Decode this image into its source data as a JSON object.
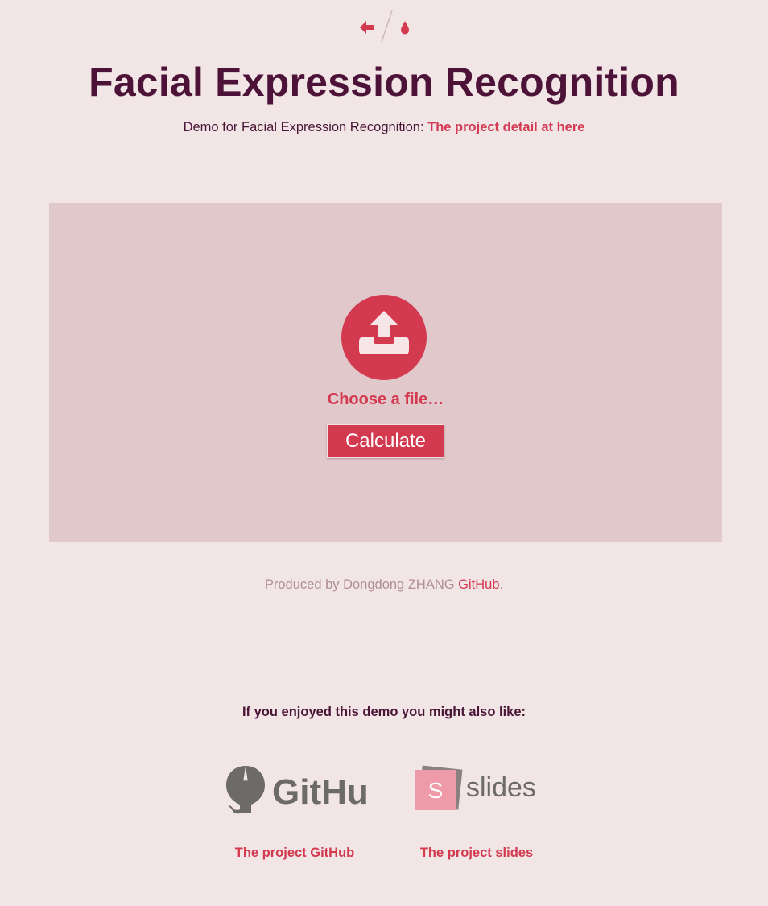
{
  "nav": {
    "back_icon": "arrow-left-icon",
    "theme_icon": "droplet-icon",
    "accent": "#d3394f"
  },
  "header": {
    "title": "Facial Expression Recognition",
    "subtitle_text": "Demo for Facial Expression Recognition: ",
    "subtitle_link": "The project detail at here"
  },
  "upload": {
    "icon": "upload-icon",
    "choose_label": "Choose a file…",
    "calculate_label": "Calculate"
  },
  "footer": {
    "credit_text": "Produced by Dongdong ZHANG ",
    "credit_link": "GitHub",
    "credit_end": "."
  },
  "related": {
    "heading": "If you enjoyed this demo you might also like:",
    "items": [
      {
        "logo_text": "GitHub",
        "link": "The project GitHub"
      },
      {
        "logo_text": "slides",
        "logo_badge": "S",
        "link": "The project slides"
      }
    ]
  },
  "colors": {
    "background": "#f1e5e6",
    "panel": "#e0c8cb",
    "title": "#4d1237",
    "accent": "#d3394f",
    "muted": "#b08e96"
  }
}
